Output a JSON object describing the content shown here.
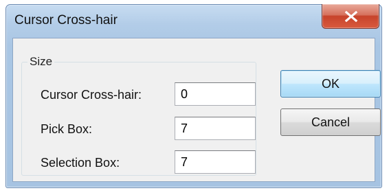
{
  "window": {
    "title": "Cursor Cross-hair",
    "close_icon": "close-icon"
  },
  "group": {
    "legend": "Size"
  },
  "fields": [
    {
      "label": "Cursor Cross-hair:",
      "value": "0"
    },
    {
      "label": "Pick Box:",
      "value": "7"
    },
    {
      "label": "Selection Box:",
      "value": "7"
    }
  ],
  "buttons": {
    "ok": "OK",
    "cancel": "Cancel"
  },
  "colors": {
    "frame": "#a9c6e4",
    "close_button": "#c7432b",
    "default_button": "#3c7fb1",
    "client_background": "#f0f0f0"
  }
}
